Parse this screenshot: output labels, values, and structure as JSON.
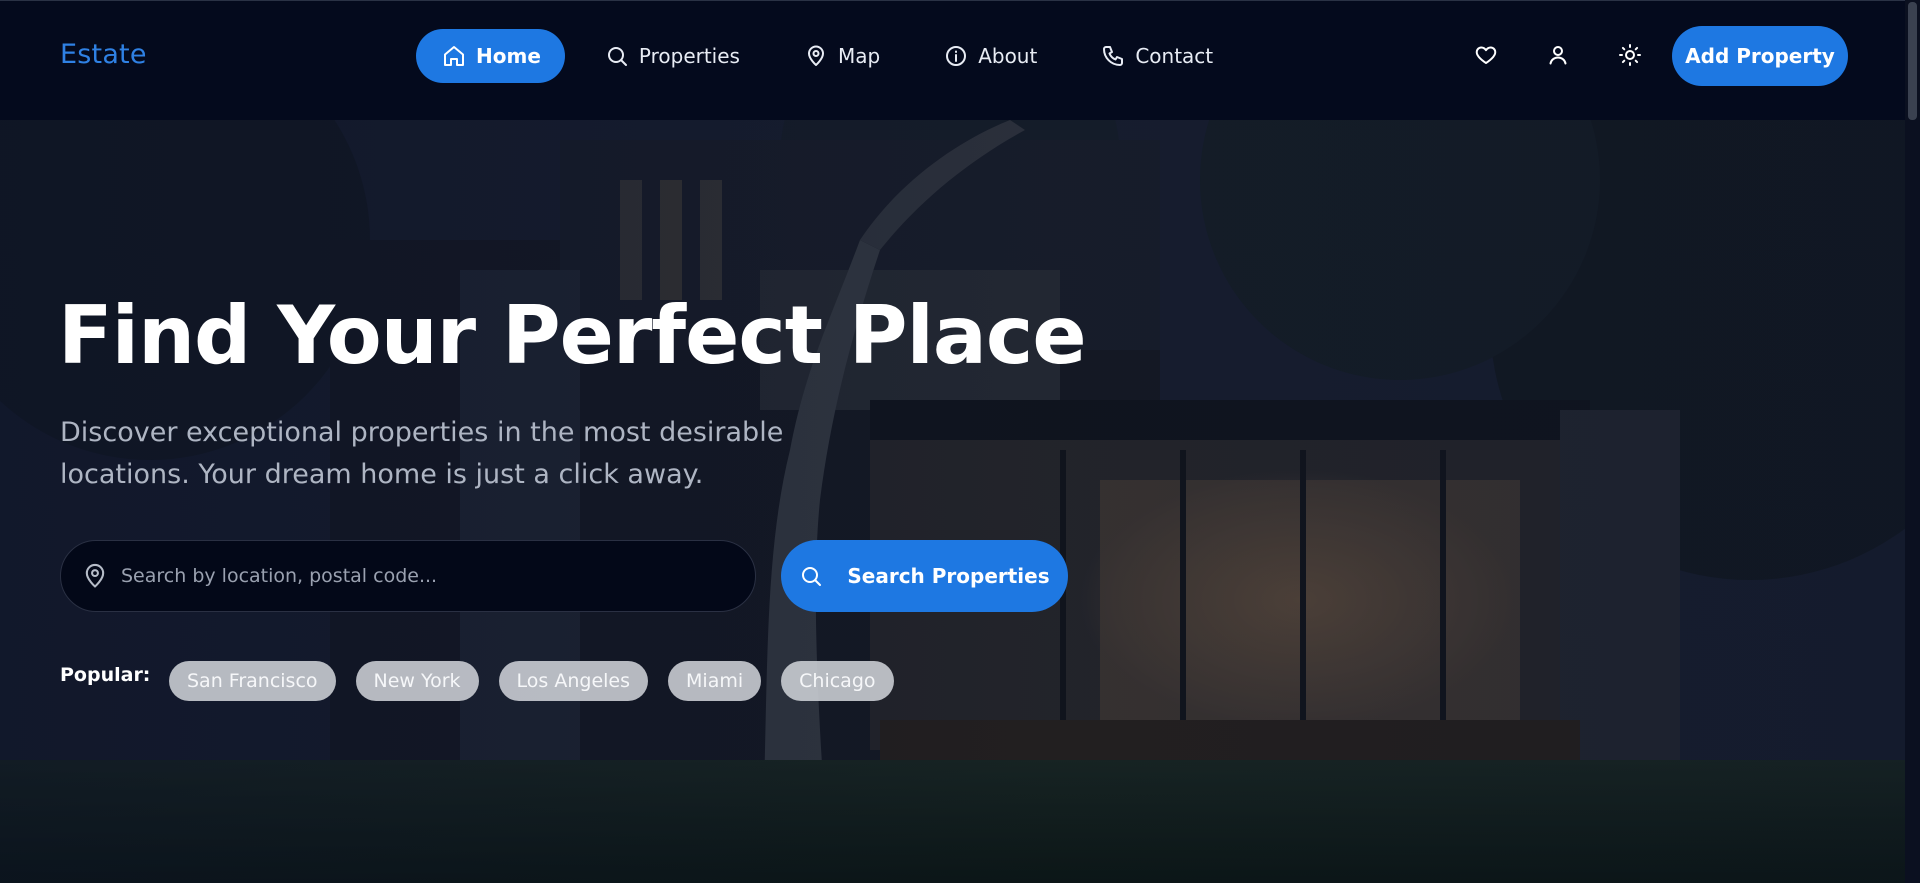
{
  "brand": "Estate",
  "nav": {
    "items": [
      {
        "label": "Home",
        "icon": "home-icon",
        "active": true
      },
      {
        "label": "Properties",
        "icon": "search-icon",
        "active": false
      },
      {
        "label": "Map",
        "icon": "map-pin-icon",
        "active": false
      },
      {
        "label": "About",
        "icon": "info-icon",
        "active": false
      },
      {
        "label": "Contact",
        "icon": "phone-icon",
        "active": false
      }
    ],
    "utilities": [
      "heart-icon",
      "user-icon",
      "sun-icon"
    ],
    "add_property": "Add Property"
  },
  "hero": {
    "title": "Find Your Perfect Place",
    "subtitle": "Discover exceptional properties in the most desirable locations. Your dream home is just a click away.",
    "search": {
      "placeholder": "Search by location, postal code...",
      "value": "",
      "button": "Search Properties"
    },
    "popular": {
      "label": "Popular:",
      "items": [
        "San Francisco",
        "New York",
        "Los Angeles",
        "Miami",
        "Chicago"
      ]
    }
  },
  "colors": {
    "accent": "#1e78e2",
    "brand": "#2f81e4",
    "nav_bg": "#040a1d"
  }
}
